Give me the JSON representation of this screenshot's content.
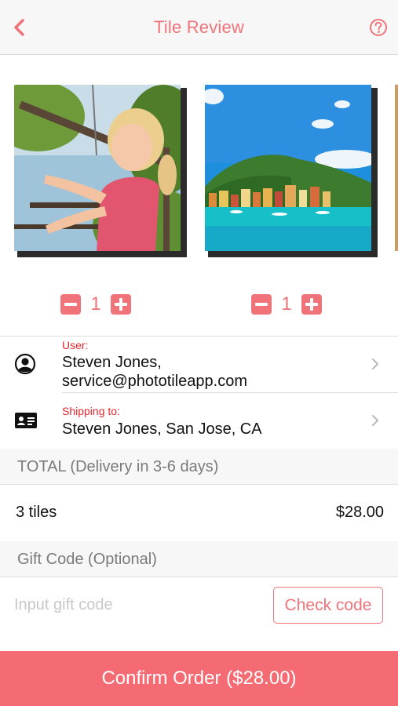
{
  "header": {
    "title": "Tile Review",
    "back_icon": "chevron-left-icon",
    "help_icon": "question-circle-icon"
  },
  "tiles": [
    {
      "image": "photo-girl-on-playground",
      "quantity": "1"
    },
    {
      "image": "photo-coastal-village",
      "quantity": "1"
    }
  ],
  "user": {
    "label": "User:",
    "name": "Steven Jones,",
    "email": "service@phototileapp.com",
    "icon": "user-circle-icon"
  },
  "shipping": {
    "label": "Shipping to:",
    "address": "Steven Jones, San Jose, CA",
    "icon": "address-card-icon"
  },
  "total": {
    "header": "TOTAL (Delivery in 3-6 days)",
    "items_label": "3 tiles",
    "price": "$28.00"
  },
  "gift": {
    "header": "Gift Code (Optional)",
    "placeholder": "Input gift code",
    "value": "",
    "check_label": "Check code"
  },
  "confirm_label": "Confirm Order ($28.00)",
  "colors": {
    "accent": "#f0737a",
    "confirm_bg": "#f56b73",
    "label_red": "#e8262e"
  }
}
